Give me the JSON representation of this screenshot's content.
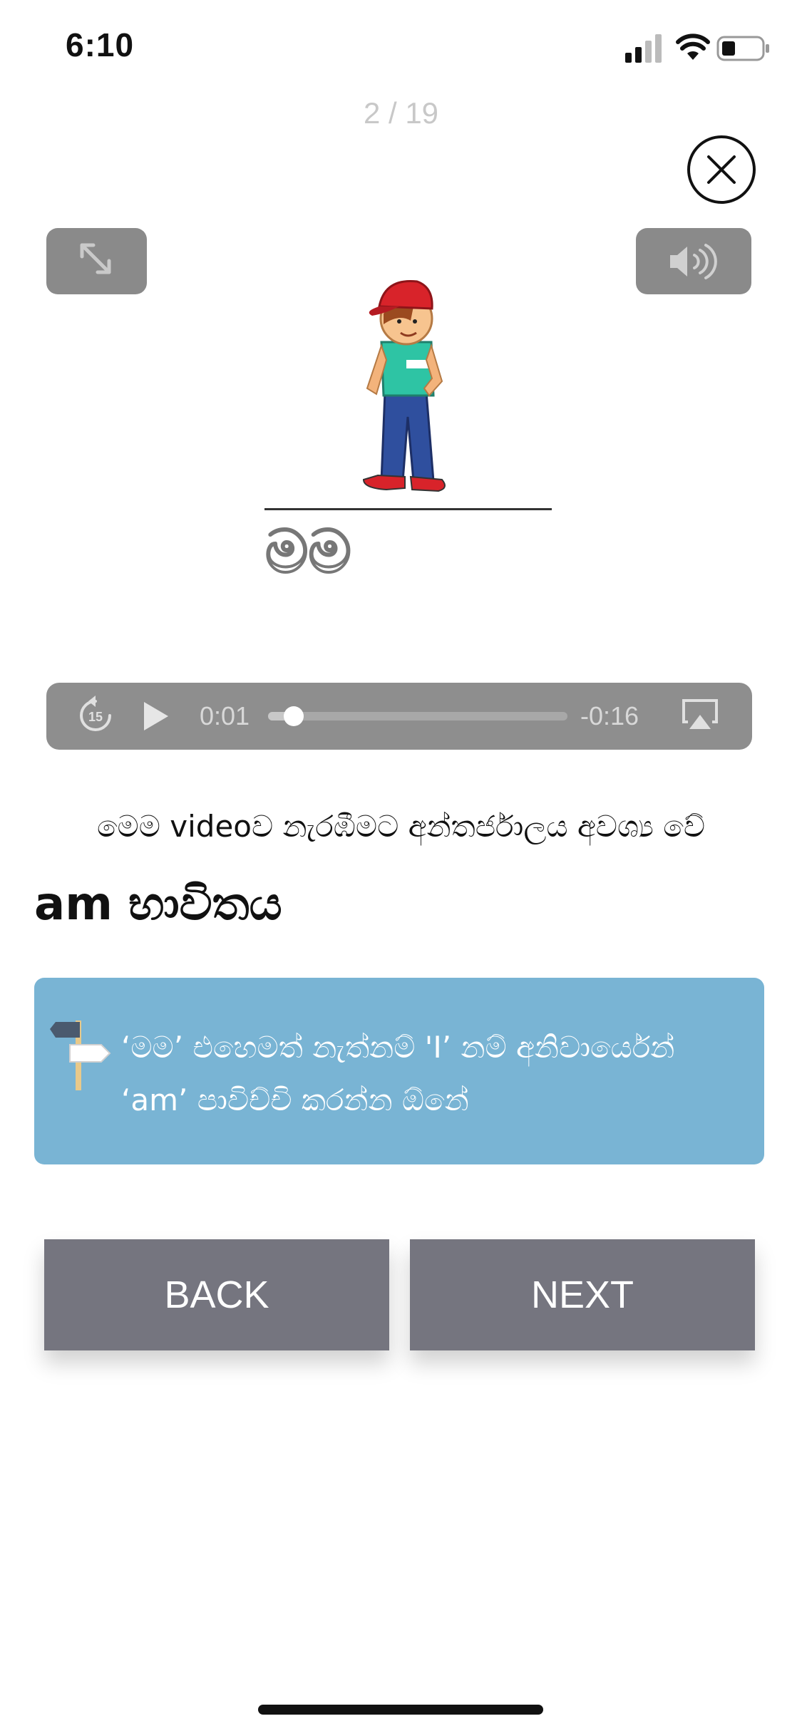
{
  "status_bar": {
    "time": "6:10"
  },
  "lesson": {
    "counter": "2 / 19",
    "word": "මම"
  },
  "video": {
    "elapsed": "0:01",
    "remaining": "-0:16",
    "progress_fraction": 0.06,
    "skip_label": "15"
  },
  "notice": "මෙම videoව නැරඹීමට අන්තර්ජාලය අවශ්‍ය වේ",
  "section_heading": "am භාවිතය",
  "tip": {
    "line1": "‘මම’ එහෙමත් නැත්නම් 'I’ නම් අනිවාර්යෙන්",
    "line2": "‘am’ පාවිච්චි කරන්න ඕනේ"
  },
  "nav": {
    "back_label": "BACK",
    "next_label": "NEXT"
  },
  "colors": {
    "tip_background": "#79b4d4",
    "nav_button": "#75757f",
    "control_gray": "#8a8a8a"
  },
  "icons": [
    "signal-icon",
    "wifi-icon",
    "battery-icon",
    "close-icon",
    "fullscreen-icon",
    "volume-icon",
    "skip-back-15-icon",
    "play-icon",
    "airplay-icon",
    "signpost-icon"
  ]
}
